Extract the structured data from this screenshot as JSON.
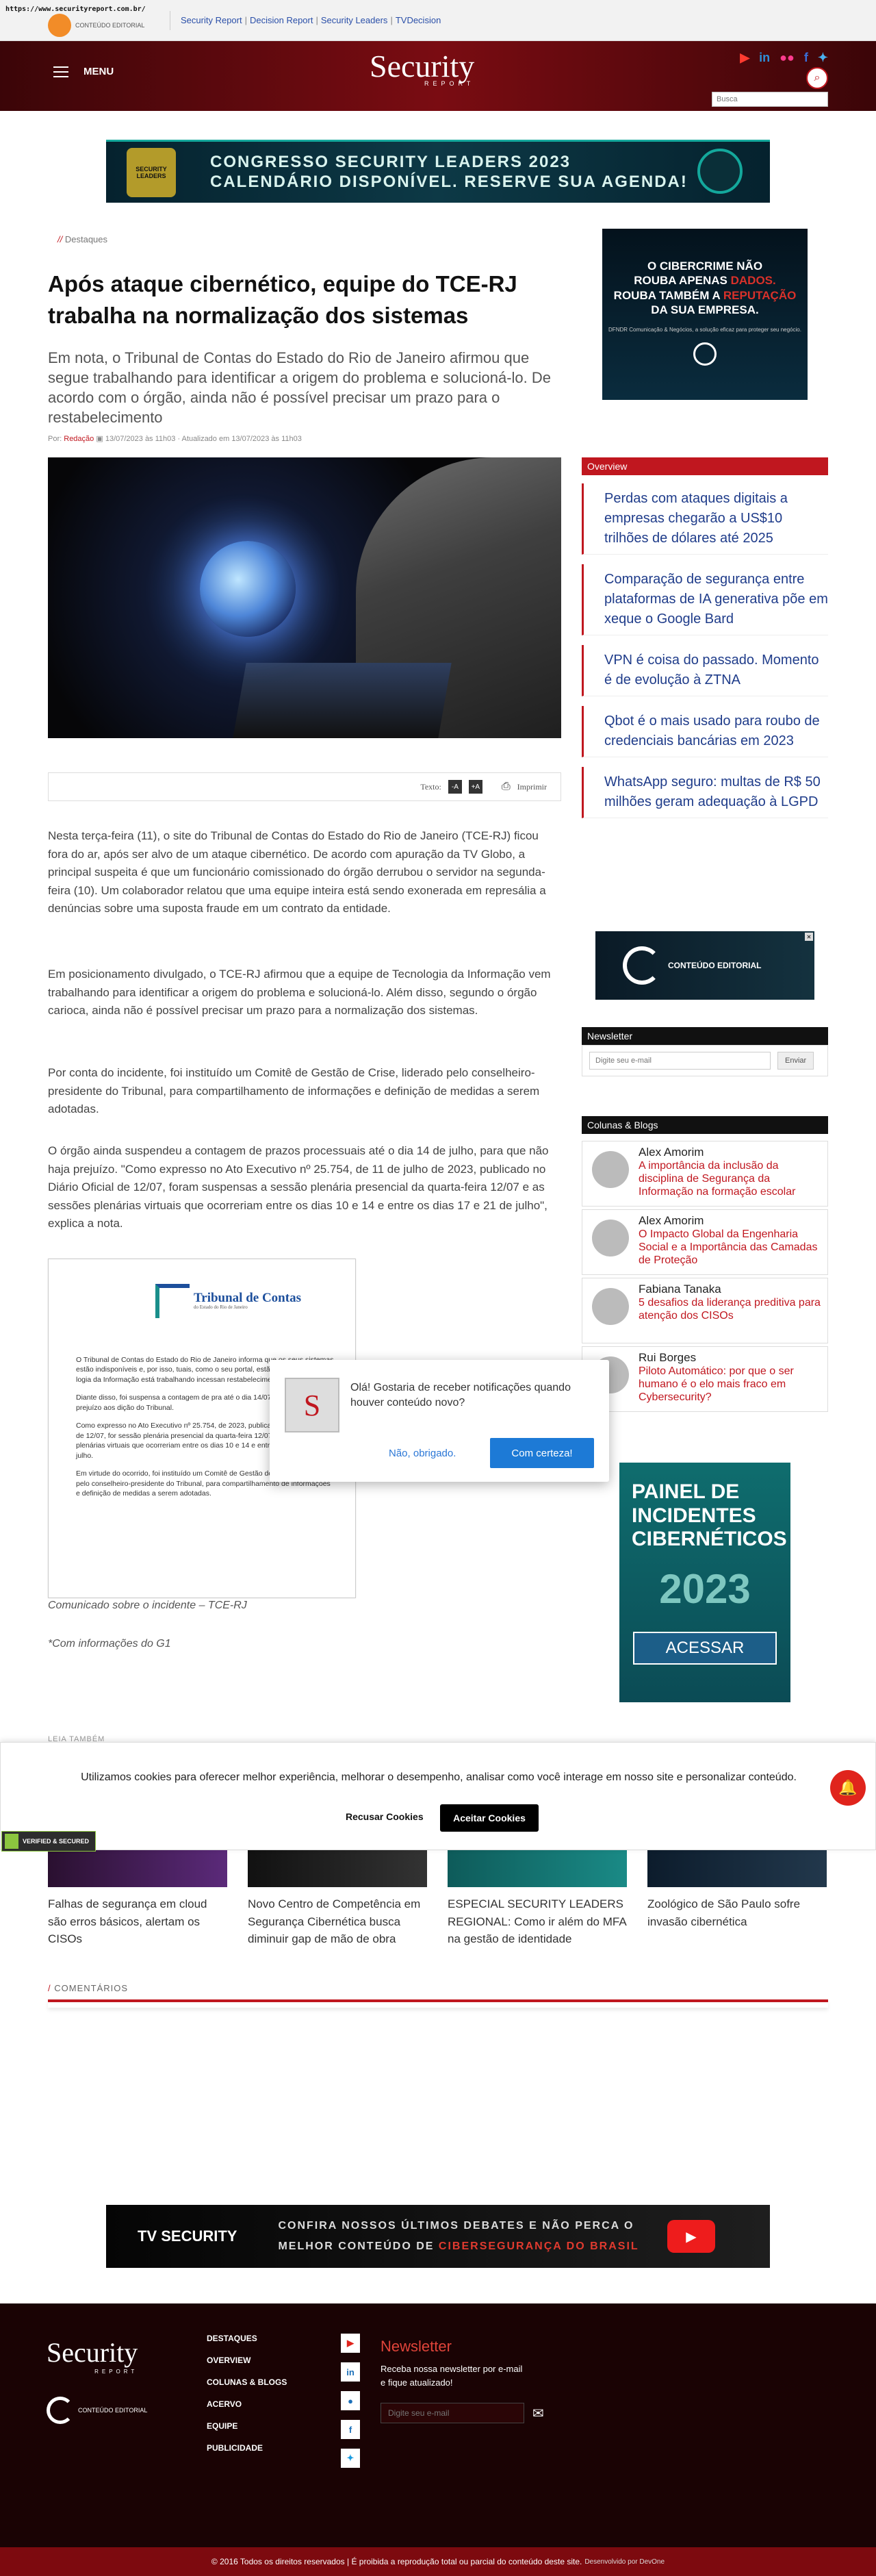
{
  "browser": {
    "url": "https://www.securityreport.com.br/"
  },
  "topbar": {
    "ce_label": "CONTEÚDO EDITORIAL",
    "links": [
      "Security Report",
      "Decision Report",
      "Security Leaders",
      "TVDecision"
    ]
  },
  "header": {
    "menu_label": "MENU",
    "logo": "Security",
    "logo_sub": "REPORT",
    "search_placeholder": "Busca",
    "socials": [
      "youtube",
      "linkedin",
      "flickr",
      "facebook",
      "twitter"
    ]
  },
  "banner_top": {
    "badge": "SECURITY LEADERS",
    "line1": "CONGRESSO SECURITY LEADERS 2023",
    "line2": "CALENDÁRIO DISPONÍVEL. RESERVE SUA AGENDA!"
  },
  "article": {
    "breadcrumb": "Destaques",
    "title": "Após ataque cibernético, equipe do TCE-RJ trabalha na normalização dos sistemas",
    "lead": "Em nota, o Tribunal de Contas do Estado do Rio de Janeiro afirmou que segue trabalhando para identificar a origem do problema e solucioná-lo. De acordo com o órgão, ainda não é possível precisar um prazo para o restabelecimento",
    "meta_by": "Por",
    "meta_author": "Redação",
    "meta_dates": "13/07/2023 às 11h03 · Atualizado em 13/07/2023 às 11h03",
    "tools_text_label": "Texto:",
    "tools_minus": "-A",
    "tools_plus": "+A",
    "tools_print": "Imprimir",
    "paragraphs": [
      "Nesta terça-feira (11), o site do Tribunal de Contas do Estado do Rio de Janeiro (TCE-RJ) ficou fora do ar, após ser alvo de um ataque cibernético. De acordo com apuração da TV Globo, a principal suspeita é que um funcionário comissionado do órgão derrubou o servidor na segunda-feira (10). Um colaborador relatou que uma equipe inteira está sendo exonerada em represália a denúncias sobre uma suposta fraude em um contrato da entidade.",
      "Em posicionamento divulgado, o TCE-RJ afirmou que a equipe de Tecnologia da Informação vem trabalhando para identificar a origem do problema e solucioná-lo. Além disso, segundo o órgão carioca, ainda não é possível precisar um prazo para a normalização dos sistemas.",
      "Por conta do incidente, foi instituído um Comitê de Gestão de Crise, liderado pelo conselheiro-presidente do Tribunal, para compartilhamento de informações e definição de medidas a serem adotadas.",
      "O órgão ainda suspendeu a contagem de prazos processuais até o dia 14 de julho, para que não haja prejuízo. \"Como expresso no Ato Executivo nº 25.754, de 11 de julho de 2023, publicado no Diário Oficial de 12/07, foram suspensas a sessão plenária presencial da quarta-feira 12/07 e as sessões plenárias virtuais que ocorreriam entre os dias 10 e 14 e entre os dias 17 e 21 de julho\", explica a nota."
    ],
    "notice": {
      "org": "Tribunal de Contas",
      "org_sub": "do Estado do Rio de Janeiro",
      "paras": [
        "O Tribunal de Contas do Estado do Rio de Janeiro informa que os seus sistemas estão indisponíveis e, por isso, tuais, como o seu portal, estão inacessíveis. A e logia da Informação está trabalhando incessan restabelecimento dos serviços.",
        "Diante disso, foi suspensa a contagem de pra até o dia 14/07, para que não haja prejuízo aos dição do Tribunal.",
        "Como expresso no Ato Executivo nº 25.754, de 2023, publicado no Diário Oficial de 12/07, for sessão plenária presencial da quarta-feira 12/07 e as sessões plenárias virtuais que ocorreriam entre os dias 10 e 14 e entre os dias 17 e 21 de julho.",
        "Em virtude do ocorrido, foi instituído um Comitê de Gestão de Crise, liderado pelo conselheiro-presidente do Tribunal, para compartilhamento de informações e definição de medidas a serem adotadas."
      ]
    },
    "caption": "Comunicado sobre o incidente – TCE-RJ",
    "source": "*Com informações do G1"
  },
  "sidebar": {
    "ad_cibercrime": {
      "line1": "O CIBERCRIME NÃO",
      "line2a": "ROUBA APENAS ",
      "line2b": "DADOS.",
      "line3a": "ROUBA TAMBÉM A ",
      "line3b": "REPUTAÇÃO",
      "line4": "DA SUA EMPRESA.",
      "small": "DFNDR Comunicação & Negócios, a solução eficaz para proteger seu negócio."
    },
    "overview_title": "Overview",
    "overview": [
      "Perdas com ataques digitais a empresas chegarão a US$10 trilhões de dólares até 2025",
      "Comparação de segurança entre plataformas de IA generativa põe em xeque o Google Bard",
      "VPN é coisa do passado. Momento é de evolução à ZTNA",
      "Qbot é o mais usado para roubo de credenciais bancárias em 2023",
      "WhatsApp seguro: multas de R$ 50 milhões geram adequação à LGPD"
    ],
    "ad_conteudo": "CONTEÚDO EDITORIAL",
    "newsletter_title": "Newsletter",
    "newsletter_placeholder": "Digite seu e-mail",
    "newsletter_button": "Enviar",
    "colunas_title": "Colunas & Blogs",
    "colunas": [
      {
        "name": "Alex Amorim",
        "title": "A importância da inclusão da disciplina de Segurança da Informação na formação escolar"
      },
      {
        "name": "Alex Amorim",
        "title": "O Impacto Global da Engenharia Social e a Importância das Camadas de Proteção"
      },
      {
        "name": "Fabiana Tanaka",
        "title": "5 desafios da liderança preditiva para atenção dos CISOs"
      },
      {
        "name": "Rui Borges",
        "title": "Piloto Automático: por que o ser humano é o elo mais fraco em Cybersecurity?"
      }
    ],
    "ad_painel": {
      "line1": "PAINEL DE",
      "line2": "INCIDENTES",
      "line3": "CIBERNÉTICOS",
      "year": "2023",
      "cta": "ACESSAR"
    }
  },
  "related": {
    "label": "LEIA TAMBÉM",
    "items": [
      "Falhas de segurança em cloud são erros básicos, alertam os CISOs",
      "Novo Centro de Competência em Segurança Cibernética busca diminuir gap de mão de obra",
      "ESPECIAL SECURITY LEADERS REGIONAL: Como ir além do MFA na gestão de identidade",
      "Zoológico de São Paulo sofre invasão cibernética"
    ]
  },
  "comments_label": "COMENTÁRIOS",
  "banner_tv": {
    "logo": "TV SECURITY",
    "line1": "CONFIRA NOSSOS ÚLTIMOS DEBATES E NÃO PERCA O",
    "line2a": "MELHOR CONTEÚDO DE ",
    "line2b": "CIBERSEGURANÇA DO BRASIL"
  },
  "footer": {
    "logo": "Security",
    "logo_sub": "REPORT",
    "ce_label": "CONTEÚDO EDITORIAL",
    "nav": [
      "DESTAQUES",
      "OVERVIEW",
      "COLUNAS & BLOGS",
      "ACERVO",
      "EQUIPE",
      "PUBLICIDADE"
    ],
    "newsletter_title": "Newsletter",
    "newsletter_text1": "Receba nossa newsletter por e-mail",
    "newsletter_text2": "e fique atualizado!",
    "newsletter_placeholder": "Digite seu e-mail",
    "copyright": "© 2016 Todos os direitos reservados | É proibida a reprodução total ou parcial do conteúdo deste site.",
    "dev": "Desenvolvido por DevOne"
  },
  "notification": {
    "message": "Olá! Gostaria de receber notificações quando houver conteúdo novo?",
    "decline": "Não, obrigado.",
    "accept": "Com certeza!"
  },
  "cookie": {
    "message": "Utilizamos cookies para oferecer melhor experiência, melhorar o desempenho, analisar como você interage em nosso site e personalizar conteúdo.",
    "reject": "Recusar Cookies",
    "accept": "Aceitar Cookies"
  },
  "verified": "VERIFIED & SECURED"
}
